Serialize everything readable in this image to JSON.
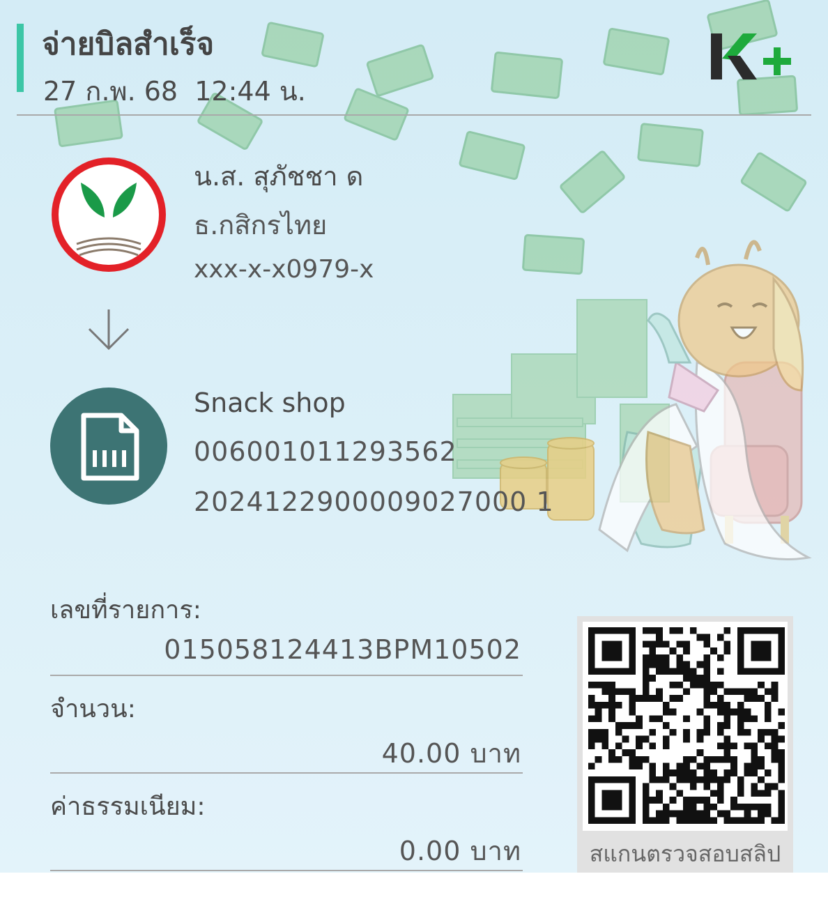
{
  "header": {
    "title": "จ่ายบิลสำเร็จ",
    "datetime": "27 ก.พ. 68  12:44 น.",
    "brand_logo": "K+"
  },
  "sender": {
    "name": "น.ส. สุภัชชา ด",
    "bank": "ธ.กสิกรไทย",
    "account": "xxx-x-x0979-x",
    "logo_icon": "kbank-logo-icon"
  },
  "payee": {
    "name": "Snack shop",
    "ref1": "006001011293562",
    "ref2": "2024122900009027000 1",
    "logo_icon": "bill-document-icon"
  },
  "details": {
    "transaction_label": "เลขที่รายการ:",
    "transaction_id": "015058124413BPM10502",
    "amount_label": "จำนวน:",
    "amount": "40.00 บาท",
    "fee_label": "ค่าธรรมเนียม:",
    "fee": "0.00 บาท"
  },
  "qr": {
    "caption": "สแกนตรวจสอบสลิป"
  },
  "colors": {
    "accent": "#3cc6a6",
    "kbank_green": "#1a9a48",
    "kbank_red": "#e32128",
    "payee_icon_bg": "#3d7474",
    "kplus_dark": "#2b2b2b",
    "kplus_green": "#1eaa3c"
  }
}
